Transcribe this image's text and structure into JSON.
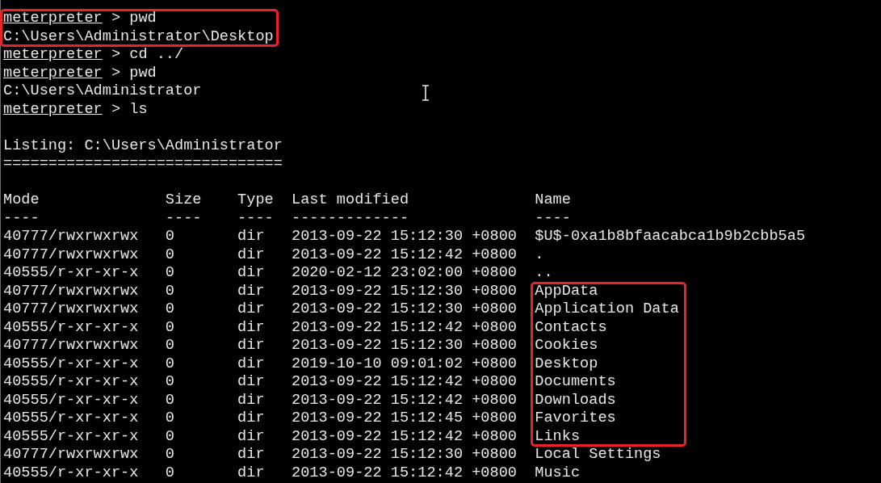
{
  "terminal": {
    "blocks": [
      {
        "highlighted": true,
        "lines": [
          {
            "kind": "command",
            "prompt": "meterpreter",
            "command": "> pwd"
          },
          {
            "kind": "output",
            "text": "C:\\Users\\Administrator\\Desktop"
          }
        ]
      },
      {
        "highlighted": false,
        "lines": [
          {
            "kind": "command",
            "prompt": "meterpreter",
            "command": "> cd ../"
          },
          {
            "kind": "command",
            "prompt": "meterpreter",
            "command": "> pwd"
          },
          {
            "kind": "output",
            "text": "C:\\Users\\Administrator"
          },
          {
            "kind": "command",
            "prompt": "meterpreter",
            "command": "> ls"
          }
        ]
      }
    ],
    "listing": {
      "title": "Listing: C:\\Users\\Administrator",
      "rule": "===============================",
      "columns": [
        "Mode",
        "Size",
        "Type",
        "Last modified",
        "Name"
      ],
      "underlines": [
        "----",
        "----",
        "----",
        "-------------",
        "----"
      ],
      "row_groups": [
        {
          "names_highlighted": false,
          "rows": [
            {
              "mode": "40777/rwxrwxrwx",
              "size": "0",
              "type": "dir",
              "modified": "2013-09-22 15:12:30 +0800",
              "name": "$U$-0xa1b8bfaacabca1b9b2cbb5a5"
            },
            {
              "mode": "40777/rwxrwxrwx",
              "size": "0",
              "type": "dir",
              "modified": "2013-09-22 15:12:42 +0800",
              "name": "."
            },
            {
              "mode": "40555/r-xr-xr-x",
              "size": "0",
              "type": "dir",
              "modified": "2020-02-12 23:02:00 +0800",
              "name": ".."
            }
          ]
        },
        {
          "names_highlighted": true,
          "rows": [
            {
              "mode": "40777/rwxrwxrwx",
              "size": "0",
              "type": "dir",
              "modified": "2013-09-22 15:12:30 +0800",
              "name": "AppData"
            },
            {
              "mode": "40777/rwxrwxrwx",
              "size": "0",
              "type": "dir",
              "modified": "2013-09-22 15:12:30 +0800",
              "name": "Application Data"
            },
            {
              "mode": "40555/r-xr-xr-x",
              "size": "0",
              "type": "dir",
              "modified": "2013-09-22 15:12:42 +0800",
              "name": "Contacts"
            },
            {
              "mode": "40777/rwxrwxrwx",
              "size": "0",
              "type": "dir",
              "modified": "2013-09-22 15:12:30 +0800",
              "name": "Cookies"
            },
            {
              "mode": "40555/r-xr-xr-x",
              "size": "0",
              "type": "dir",
              "modified": "2019-10-10 09:01:02 +0800",
              "name": "Desktop"
            },
            {
              "mode": "40555/r-xr-xr-x",
              "size": "0",
              "type": "dir",
              "modified": "2013-09-22 15:12:42 +0800",
              "name": "Documents"
            },
            {
              "mode": "40555/r-xr-xr-x",
              "size": "0",
              "type": "dir",
              "modified": "2013-09-22 15:12:42 +0800",
              "name": "Downloads"
            },
            {
              "mode": "40555/r-xr-xr-x",
              "size": "0",
              "type": "dir",
              "modified": "2013-09-22 15:12:45 +0800",
              "name": "Favorites"
            },
            {
              "mode": "40555/r-xr-xr-x",
              "size": "0",
              "type": "dir",
              "modified": "2013-09-22 15:12:42 +0800",
              "name": "Links"
            }
          ]
        },
        {
          "names_highlighted": false,
          "rows": [
            {
              "mode": "40777/rwxrwxrwx",
              "size": "0",
              "type": "dir",
              "modified": "2013-09-22 15:12:30 +0800",
              "name": "Local Settings"
            },
            {
              "mode": "40555/r-xr-xr-x",
              "size": "0",
              "type": "dir",
              "modified": "2013-09-22 15:12:42 +0800",
              "name": "Music"
            }
          ]
        }
      ]
    }
  }
}
